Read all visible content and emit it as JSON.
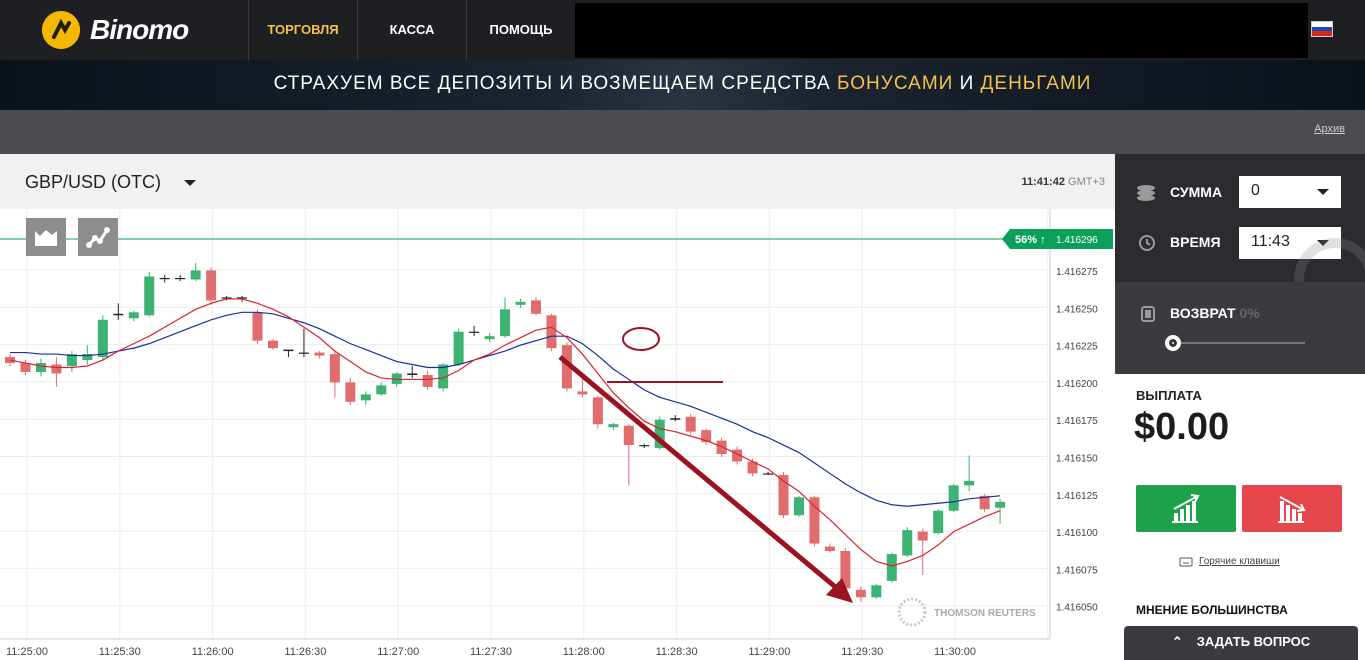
{
  "brand": {
    "name": "Binomo"
  },
  "nav": {
    "items": [
      "ТОРГОВЛЯ",
      "КАССА",
      "ПОМОЩЬ"
    ],
    "active_color": "#f3c24b"
  },
  "banner": {
    "part1": "СТРАХУЕМ ВСЕ ДЕПОЗИТЫ И ВОЗМЕЩАЕМ СРЕДСТВА ",
    "bonus": "БОНУСАМИ",
    "and": " И ",
    "money": "ДЕНЬГАМИ"
  },
  "subbar": {
    "archive": "Архив"
  },
  "chart_header": {
    "asset": "GBP/USD (OTC)",
    "time": "11:41:42",
    "timezone": "GMT+3"
  },
  "panel": {
    "amount_label": "СУММА",
    "amount_value": "0",
    "time_label": "ВРЕМЯ",
    "time_value": "11:43",
    "return_label": "ВОЗВРАТ",
    "return_value": "0%",
    "payout_label": "ВЫПЛАТА",
    "payout_value": "$0.00",
    "hotkeys": "Горячие клавиши",
    "majority": "МНЕНИЕ БОЛЬШИНСТВА",
    "ask": "ЗАДАТЬ ВОПРОС"
  },
  "colors": {
    "up": "#3cb371",
    "down": "#e06c6e",
    "ma_fast": "#d9232a",
    "ma_slow": "#1b2ea0",
    "price_tag": "#0aa05a",
    "annotation": "#9b1220"
  },
  "watermark": "THOMSON REUTERS",
  "chart_data": {
    "type": "candlestick",
    "price_tag": {
      "percent": "56%",
      "value": "1.416296"
    },
    "y_ticks": [
      "1.416275",
      "1.416250",
      "1.416225",
      "1.416200",
      "1.416175",
      "1.416150",
      "1.416125",
      "1.416100",
      "1.416075",
      "1.416050"
    ],
    "x_ticks": [
      "11:25:00",
      "11:25:30",
      "11:26:00",
      "11:26:30",
      "11:27:00",
      "11:27:30",
      "11:28:00",
      "11:28:30",
      "11:29:00",
      "11:29:30",
      "11:30:00"
    ],
    "ylim": [
      1.41604,
      1.41631
    ],
    "candles": [
      [
        1.41622,
        1.416216,
        1.416222,
        1.416214
      ],
      [
        1.416216,
        1.41621,
        1.416218,
        1.416208
      ],
      [
        1.41621,
        1.416216,
        1.416219,
        1.416207
      ],
      [
        1.416215,
        1.416209,
        1.41622,
        1.4162
      ],
      [
        1.416214,
        1.416222,
        1.416224,
        1.41621
      ],
      [
        1.416218,
        1.416222,
        1.416228,
        1.416215
      ],
      [
        1.41622,
        1.416245,
        1.416248,
        1.416218
      ],
      [
        1.416249,
        1.416248,
        1.416256,
        1.416245
      ],
      [
        1.416246,
        1.41625,
        1.416251,
        1.416244
      ],
      [
        1.416248,
        1.416274,
        1.416277,
        1.416247
      ],
      [
        1.416273,
        1.416273,
        1.416275,
        1.41627
      ],
      [
        1.416273,
        1.416273,
        1.416275,
        1.416271
      ],
      [
        1.416272,
        1.416278,
        1.416283,
        1.416271
      ],
      [
        1.416278,
        1.416258,
        1.41628,
        1.416255
      ],
      [
        1.41626,
        1.41626,
        1.416261,
        1.416258
      ],
      [
        1.41626,
        1.41626,
        1.416261,
        1.416257
      ],
      [
        1.41625,
        1.416231,
        1.416252,
        1.416229
      ],
      [
        1.416231,
        1.416226,
        1.416232,
        1.416225
      ],
      [
        1.416225,
        1.416224,
        1.416225,
        1.41622
      ],
      [
        1.416223,
        1.416223,
        1.416239,
        1.41622
      ],
      [
        1.416223,
        1.416221,
        1.416224,
        1.416219
      ],
      [
        1.416222,
        1.416203,
        1.416224,
        1.416193
      ],
      [
        1.416203,
        1.41619,
        1.416206,
        1.416188
      ],
      [
        1.416191,
        1.416195,
        1.416197,
        1.416188
      ],
      [
        1.416195,
        1.416201,
        1.416203,
        1.416194
      ],
      [
        1.416202,
        1.416209,
        1.41621,
        1.4162
      ],
      [
        1.416209,
        1.416208,
        1.416214,
        1.416206
      ],
      [
        1.416208,
        1.4162,
        1.416211,
        1.416198
      ],
      [
        1.416199,
        1.416215,
        1.416216,
        1.416197
      ],
      [
        1.416215,
        1.416237,
        1.416239,
        1.416214
      ],
      [
        1.416237,
        1.416237,
        1.416241,
        1.416234
      ],
      [
        1.416232,
        1.416234,
        1.416236,
        1.41623
      ],
      [
        1.416234,
        1.416252,
        1.41626,
        1.416233
      ],
      [
        1.416255,
        1.416257,
        1.416259,
        1.416253
      ],
      [
        1.416258,
        1.416249,
        1.41626,
        1.416248
      ],
      [
        1.416248,
        1.416226,
        1.416249,
        1.416224
      ],
      [
        1.416228,
        1.416199,
        1.41623,
        1.416197
      ],
      [
        1.416197,
        1.416195,
        1.416207,
        1.416193
      ],
      [
        1.416193,
        1.416175,
        1.416194,
        1.416172
      ],
      [
        1.416173,
        1.416175,
        1.416176,
        1.416171
      ],
      [
        1.416174,
        1.416161,
        1.416175,
        1.416134
      ],
      [
        1.416161,
        1.416161,
        1.416162,
        1.416159
      ],
      [
        1.416159,
        1.416178,
        1.41618,
        1.416158
      ],
      [
        1.416178,
        1.416179,
        1.416181,
        1.416177
      ],
      [
        1.41618,
        1.41617,
        1.416182,
        1.416168
      ],
      [
        1.416171,
        1.416163,
        1.416172,
        1.416161
      ],
      [
        1.416164,
        1.416155,
        1.416166,
        1.416153
      ],
      [
        1.416158,
        1.41615,
        1.41616,
        1.416148
      ],
      [
        1.41615,
        1.416142,
        1.416152,
        1.41614
      ],
      [
        1.416142,
        1.416142,
        1.416143,
        1.416141
      ],
      [
        1.416141,
        1.416114,
        1.416143,
        1.416112
      ],
      [
        1.416114,
        1.416126,
        1.416127,
        1.416113
      ],
      [
        1.416126,
        1.416095,
        1.416127,
        1.416093
      ],
      [
        1.416093,
        1.41609,
        1.416095,
        1.416089
      ],
      [
        1.41609,
        1.416065,
        1.416092,
        1.416063
      ],
      [
        1.416064,
        1.416059,
        1.416066,
        1.416056
      ],
      [
        1.416059,
        1.416067,
        1.416068,
        1.416058
      ],
      [
        1.41607,
        1.416088,
        1.416089,
        1.416069
      ],
      [
        1.416087,
        1.416104,
        1.416106,
        1.416086
      ],
      [
        1.416103,
        1.416097,
        1.416105,
        1.416074
      ],
      [
        1.416102,
        1.416117,
        1.416118,
        1.416101
      ],
      [
        1.416117,
        1.416134,
        1.416135,
        1.416116
      ],
      [
        1.416134,
        1.416137,
        1.416154,
        1.41613
      ],
      [
        1.416127,
        1.416118,
        1.416128,
        1.416116
      ],
      [
        1.416119,
        1.416123,
        1.416125,
        1.416108
      ]
    ],
    "ma_fast": [
      1.416218,
      1.416216,
      1.416214,
      1.416213,
      1.416213,
      1.416214,
      1.416218,
      1.416224,
      1.416229,
      1.416234,
      1.41624,
      1.416246,
      1.416252,
      1.416256,
      1.416259,
      1.416259,
      1.416256,
      1.416252,
      1.416247,
      1.41624,
      1.416233,
      1.416224,
      1.416217,
      1.41621,
      1.416206,
      1.416205,
      1.416205,
      1.416205,
      1.416206,
      1.416211,
      1.416218,
      1.416222,
      1.416228,
      1.416233,
      1.416238,
      1.41624,
      1.416233,
      1.416222,
      1.416209,
      1.416196,
      1.416186,
      1.416177,
      1.416172,
      1.41617,
      1.416167,
      1.416164,
      1.41616,
      1.416155,
      1.41615,
      1.416145,
      1.416137,
      1.41613,
      1.41612,
      1.416111,
      1.416101,
      1.416091,
      1.416083,
      1.41608,
      1.416083,
      1.416087,
      1.416094,
      1.416103,
      1.416108,
      1.416113,
      1.416117
    ],
    "ma_slow": [
      1.416223,
      1.416223,
      1.416222,
      1.416222,
      1.416221,
      1.416221,
      1.416222,
      1.416224,
      1.416226,
      1.416229,
      1.416233,
      1.416237,
      1.416241,
      1.416245,
      1.416248,
      1.41625,
      1.41625,
      1.416249,
      1.416246,
      1.416243,
      1.416239,
      1.416234,
      1.416229,
      1.416225,
      1.416221,
      1.416217,
      1.416215,
      1.416213,
      1.416213,
      1.416215,
      1.416218,
      1.416221,
      1.416224,
      1.416228,
      1.416231,
      1.416234,
      1.416234,
      1.416229,
      1.416221,
      1.416212,
      1.416205,
      1.416198,
      1.416193,
      1.41619,
      1.416187,
      1.416183,
      1.416179,
      1.416175,
      1.41617,
      1.416166,
      1.416161,
      1.416156,
      1.416149,
      1.416142,
      1.416135,
      1.416129,
      1.416124,
      1.416121,
      1.41612,
      1.416121,
      1.416122,
      1.416123,
      1.416125,
      1.416126,
      1.416127
    ]
  }
}
